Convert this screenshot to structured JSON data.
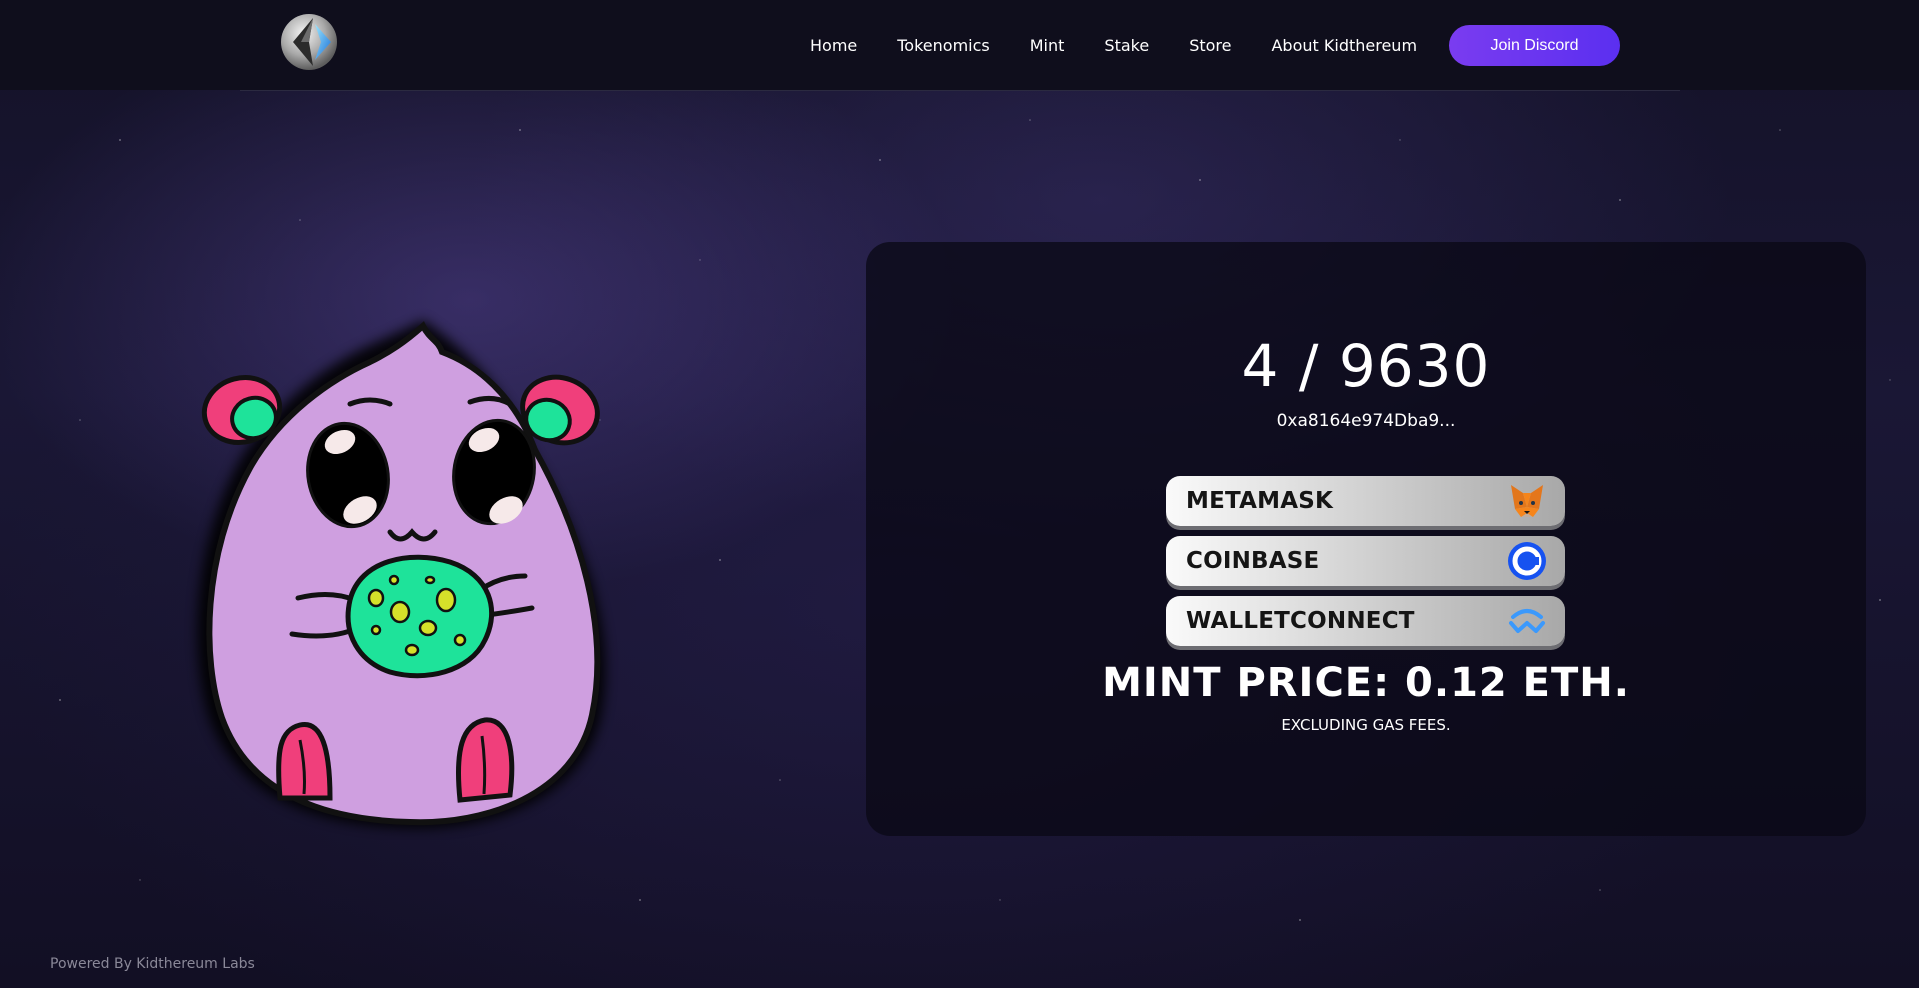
{
  "header": {
    "nav": [
      "Home",
      "Tokenomics",
      "Mint",
      "Stake",
      "Store",
      "About Kidthereum"
    ],
    "discord_label": "Join Discord"
  },
  "mint": {
    "supply": "4 / 9630",
    "address": "0xa8164e974Dba9...",
    "wallets": [
      {
        "label": "METAMASK",
        "icon": "metamask-fox-icon"
      },
      {
        "label": "COINBASE",
        "icon": "coinbase-icon"
      },
      {
        "label": "WALLETCONNECT",
        "icon": "walletconnect-icon"
      }
    ],
    "price": "MINT PRICE: 0.12 ETH.",
    "gas_note": "EXCLUDING GAS FEES."
  },
  "footer": {
    "text": "Powered By Kidthereum Labs"
  },
  "colors": {
    "accent": "#6a35f0",
    "character_body": "#cf9fe0",
    "character_belly": "#1ee39a",
    "character_ears": "#f03f7b",
    "coinbase_blue": "#1652f0",
    "walletconnect_blue": "#3b99fc"
  }
}
